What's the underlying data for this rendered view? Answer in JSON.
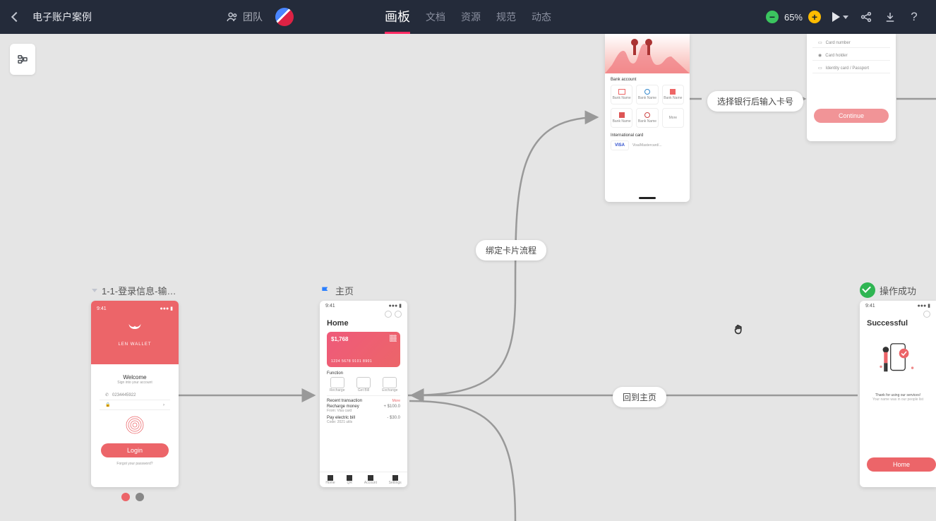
{
  "header": {
    "project_title": "电子账户案例",
    "team_label": "团队",
    "tabs": {
      "board": "画板",
      "docs": "文档",
      "resources": "资源",
      "specs": "规范",
      "activity": "动态"
    },
    "zoom": "65%"
  },
  "flow_labels": {
    "bind_card": "绑定卡片流程",
    "select_bank": "选择银行后输入卡号",
    "back_home": "回到主页"
  },
  "artboards": {
    "login": {
      "label": "1-1-登录信息-输…",
      "time": "9:41",
      "brand": "LEN WALLET",
      "welcome": "Welcome",
      "welcome_sub": "Sign into your account",
      "phone_placeholder": "0234445922",
      "login_btn": "Login",
      "forgot": "Forgot your password?"
    },
    "home": {
      "label": "主页",
      "time": "9:41",
      "title": "Home",
      "card_balance": "$1,768",
      "card_number": "1234 5678 9101 8901",
      "function": "Function",
      "func1": "Recharge",
      "func2": "Get Bill",
      "func3": "Exchange",
      "recent": "Recent transaction",
      "more": "More",
      "txn1_t": "Recharge money",
      "txn1_s": "From: Visa card",
      "txn1_v": "+ $100.0",
      "txn2_t": "Pay electric bill",
      "txn2_s": "Code: 2021 utils",
      "txn2_v": "- $30.0",
      "nav1": "Home",
      "nav2": "QR",
      "nav3": "Account",
      "nav4": "Settings"
    },
    "bank": {
      "title": "Bank account",
      "b1": "Bank Name",
      "b2": "Bank Name",
      "b3": "Bank Name",
      "b4": "Bank Name",
      "b5": "Bank Name",
      "more": "More",
      "intl": "International card",
      "visa": "VISA",
      "visa_sub": "Visa/Mastercard/..."
    },
    "card_form": {
      "f1": "Card number",
      "f2": "Card holder",
      "f3": "Identity card / Passport",
      "btn": "Continue"
    },
    "success": {
      "label": "操作成功",
      "time": "9:41",
      "title": "Successful",
      "msg1": "Thank for using our services!",
      "msg2": "Your name was in our people list",
      "btn": "Home"
    }
  }
}
